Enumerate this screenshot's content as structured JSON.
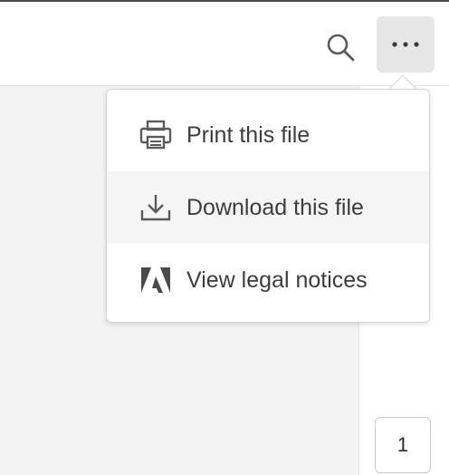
{
  "toolbar": {
    "search_icon": "search-icon",
    "more_icon": "more-horizontal-icon"
  },
  "menu": {
    "items": [
      {
        "label": "Print this file",
        "icon": "printer-icon"
      },
      {
        "label": "Download this file",
        "icon": "download-icon"
      },
      {
        "label": "View legal notices",
        "icon": "adobe-logo-icon"
      }
    ]
  },
  "page_navigator": {
    "current_page": "1"
  },
  "colors": {
    "canvas": "#f3f3f3",
    "panel": "#ffffff",
    "icon": "#5a5a5a",
    "text": "#3d3d3d",
    "hover": "#f5f5f5",
    "button_active": "#e6e6e6"
  }
}
